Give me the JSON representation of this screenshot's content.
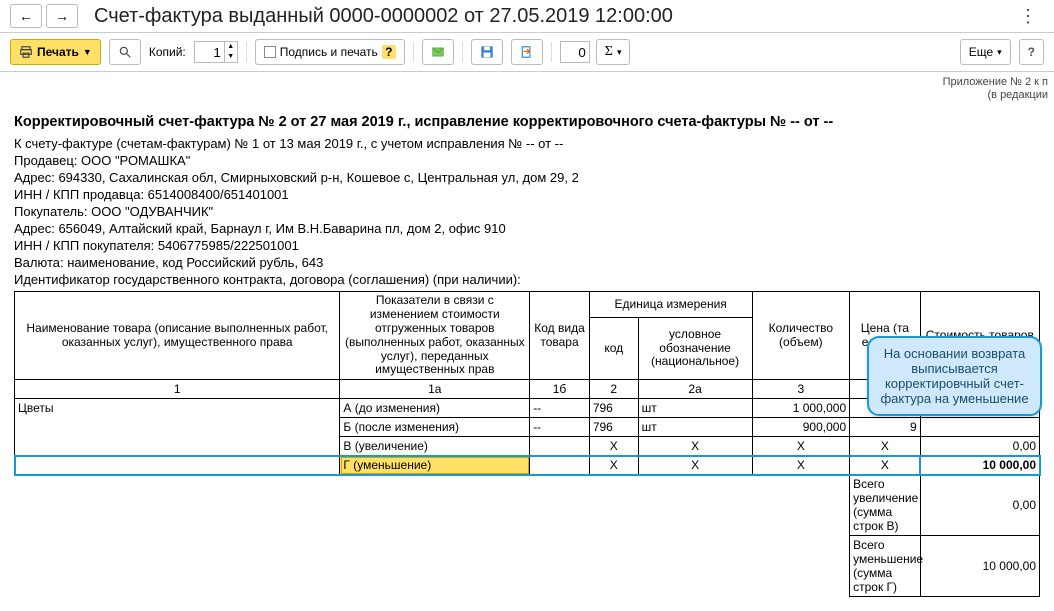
{
  "titlebar": {
    "title": "Счет-фактура выданный 0000-0000002 от 27.05.2019 12:00:00"
  },
  "toolbar": {
    "print": "Печать",
    "copies_label": "Копий:",
    "copies_value": "1",
    "sign_print": "Подпись и печать",
    "sigma_value": "0",
    "more": "Еще"
  },
  "appendix": {
    "line1": "Приложение № 2 к п",
    "line2": "(в редакции"
  },
  "doc": {
    "heading": "Корректировочный счет-фактура № 2 от 27 мая 2019 г., исправление корректировочного счета-фактуры № -- от --",
    "base": "К счету-фактуре (счетам-фактурам) № 1 от 13 мая 2019 г., с учетом исправления № -- от --",
    "seller": "Продавец: ООО \"РОМАШКА\"",
    "seller_addr": "Адрес: 694330, Сахалинская обл, Смирныховский р-н, Кошевое с, Центральная ул, дом 29, 2",
    "seller_inn": "ИНН / КПП продавца: 6514008400/651401001",
    "buyer": "Покупатель: ООО \"ОДУВАНЧИК\"",
    "buyer_addr": "Адрес: 656049, Алтайский край, Барнаул г, Им В.Н.Баварина пл, дом 2, офис 910",
    "buyer_inn": "ИНН / КПП покупателя: 5406775985/222501001",
    "currency": "Валюта: наименование, код Российский рубль, 643",
    "contract": "Идентификатор государственного контракта, договора (соглашения) (при наличии):"
  },
  "headers": {
    "col1": "Наименование товара (описание выполненных работ, оказанных услуг), имущественного права",
    "col1a": "Показатели в связи с изменением стоимости отгруженных товаров (выполненных работ, оказанных услуг), переданных имущественных прав",
    "col1b": "Код вида товара",
    "unit_group": "Единица измерения",
    "col2": "код",
    "col2a": "условное обозначение (национальное)",
    "col3": "Количество (объем)",
    "col4": "Цена (та единицу",
    "col5": "Стоимость товаров",
    "num1": "1",
    "num1a": "1а",
    "num1b": "1б",
    "num2": "2",
    "num2a": "2а",
    "num3": "3"
  },
  "rows": {
    "item": "Цветы",
    "a_label": "А (до изменения)",
    "b_label": "Б (после изменения)",
    "v_label": "В (увеличение)",
    "g_label": "Г (уменьшение)",
    "dash": "--",
    "x": "X",
    "code": "796",
    "unit": "шт",
    "qty_a": "1 000,000",
    "qty_b": "900,000",
    "cost_v": "0,00",
    "cost_g": "10 000,00",
    "q_sym": "9"
  },
  "totals": {
    "inc_label": "Всего увеличение (сумма строк В)",
    "inc_val": "0,00",
    "dec_label": "Всего уменьшение (сумма строк Г)",
    "dec_val": "10 000,00"
  },
  "callout": "На основании возврата выписывается корректировчный счет-фактура на уменьшение"
}
